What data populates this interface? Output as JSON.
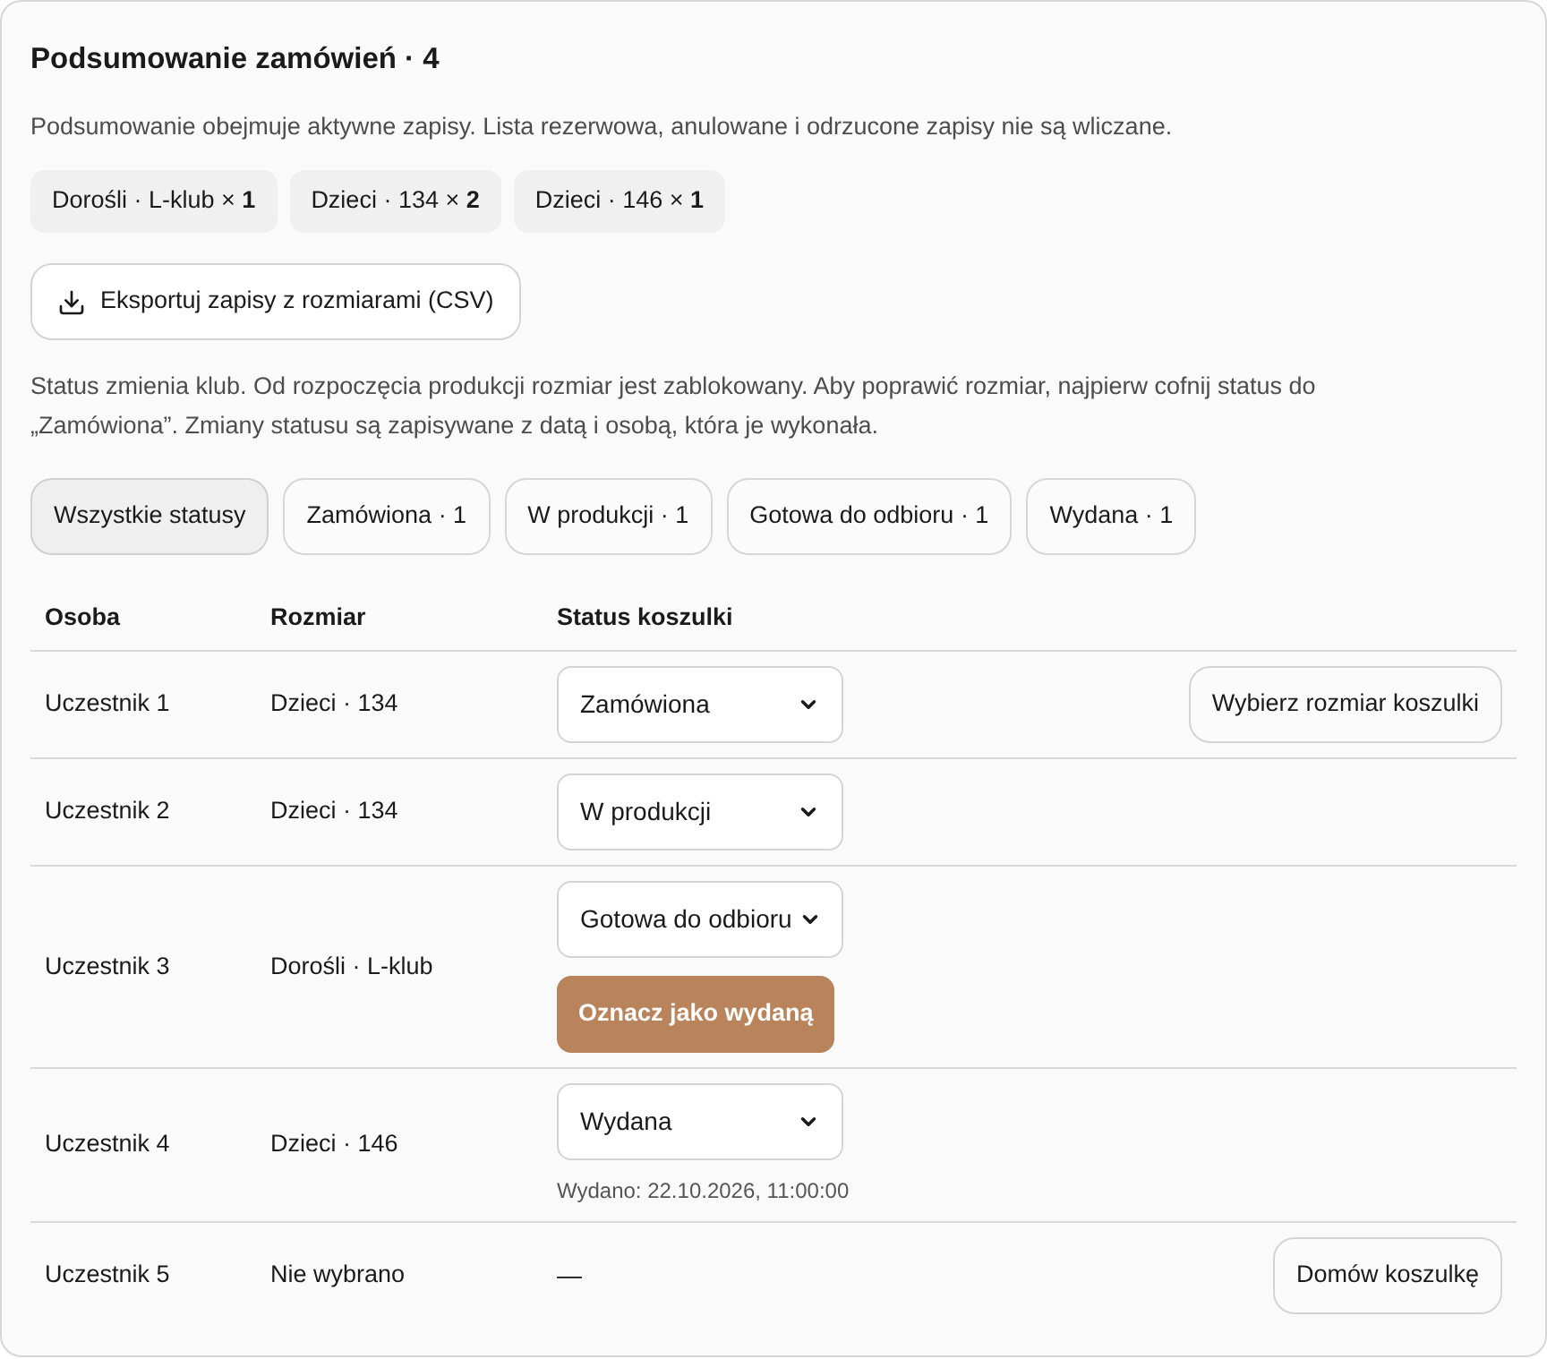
{
  "title": "Podsumowanie zamówień · 4",
  "description": "Podsumowanie obejmuje aktywne zapisy. Lista rezerwowa, anulowane i odrzucone zapisy nie są wliczane.",
  "size_chips": [
    "Dorośli · L-klub × **1**",
    "Dzieci · 134 × **2**",
    "Dzieci · 146 × **1**"
  ],
  "export_button": "Eksportuj zapisy z rozmiarami (CSV)",
  "status_note": "Status zmienia klub. Od rozpoczęcia produkcji rozmiar jest zablokowany. Aby poprawić rozmiar, najpierw cofnij status do „Zamówiona”. Zmiany statusu są zapisywane z datą i osobą, która je wykonała.",
  "filters": [
    {
      "label": "Wszystkie statusy",
      "selected": true
    },
    {
      "label": "Zamówiona · 1",
      "selected": false
    },
    {
      "label": "W produkcji · 1",
      "selected": false
    },
    {
      "label": "Gotowa do odbioru · 1",
      "selected": false
    },
    {
      "label": "Wydana · 1",
      "selected": false
    }
  ],
  "table": {
    "columns": [
      "Osoba",
      "Rozmiar",
      "Status koszulki"
    ],
    "rows": [
      {
        "person": "Uczestnik 1",
        "size": "Dzieci · 134",
        "status": {
          "kind": "select",
          "value": "Zamówiona"
        },
        "action": "Wybierz rozmiar koszulki"
      },
      {
        "person": "Uczestnik 2",
        "size": "Dzieci · 134",
        "status": {
          "kind": "select",
          "value": "W produkcji"
        }
      },
      {
        "person": "Uczestnik 3",
        "size": "Dorośli · L-klub",
        "status": {
          "kind": "select",
          "value": "Gotowa do odbioru"
        },
        "primary_button": "Oznacz jako wydaną"
      },
      {
        "person": "Uczestnik 4",
        "size": "Dzieci · 146",
        "status": {
          "kind": "select",
          "value": "Wydana"
        },
        "note": "Wydano: 22.10.2026, 11:00:00"
      },
      {
        "person": "Uczestnik 5",
        "size": "Nie wybrano",
        "status": {
          "kind": "text",
          "value": "—"
        },
        "action": "Domów koszulkę"
      }
    ]
  }
}
